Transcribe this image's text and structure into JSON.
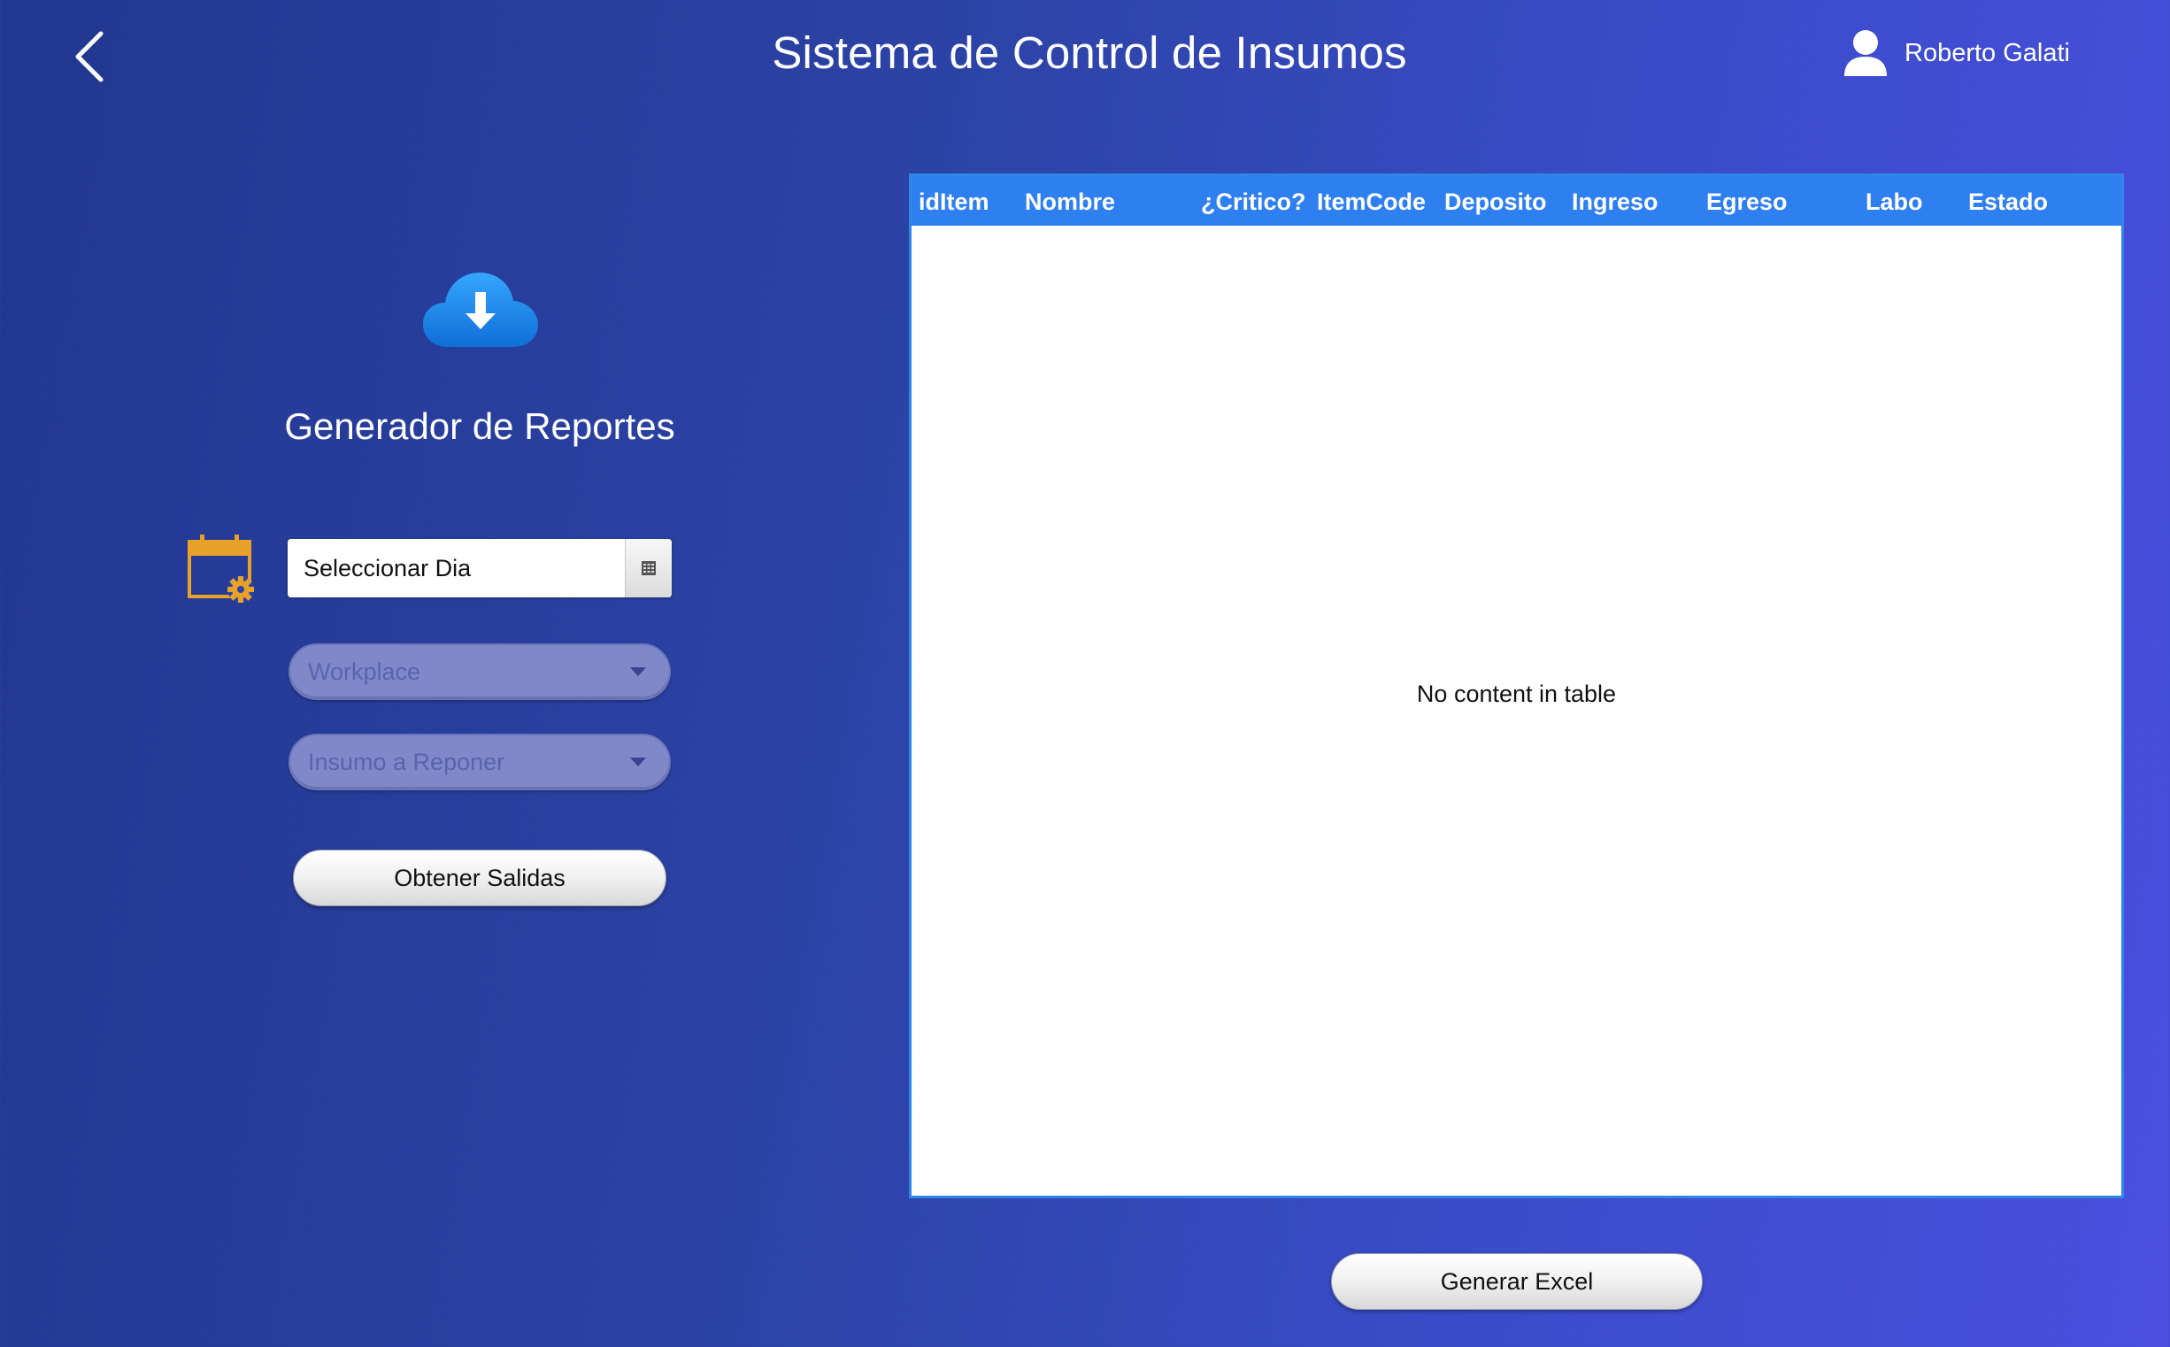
{
  "header": {
    "title": "Sistema de Control de Insumos",
    "user_name": "Roberto Galati",
    "back_icon": "chevron-left-icon",
    "user_icon": "user-icon"
  },
  "left_panel": {
    "section_title": "Generador de Reportes",
    "cloud_icon": "cloud-download-icon",
    "calendar_icon": "calendar-gear-icon",
    "date_picker": {
      "value": "Seleccionar Dia",
      "button_icon": "calendar-grid-icon"
    },
    "workplace_combo": {
      "placeholder": "Workplace"
    },
    "insumo_combo": {
      "placeholder": "Insumo a Reponer"
    },
    "obtener_button": "Obtener Salidas"
  },
  "table": {
    "columns": [
      "idItem",
      "Nombre",
      "¿Critico?",
      "ItemCode",
      "Deposito",
      "Ingreso",
      "Egreso",
      "Labo",
      "Estado"
    ],
    "empty_message": "No content in table"
  },
  "footer": {
    "excel_button": "Generar Excel"
  },
  "colors": {
    "background_start": "#22378f",
    "background_end": "#4a4fe0",
    "table_header": "#2e7ff0",
    "table_border": "#2d86e8",
    "calendar_accent": "#e8a22a",
    "cloud_blue": "#1f8ef0"
  }
}
